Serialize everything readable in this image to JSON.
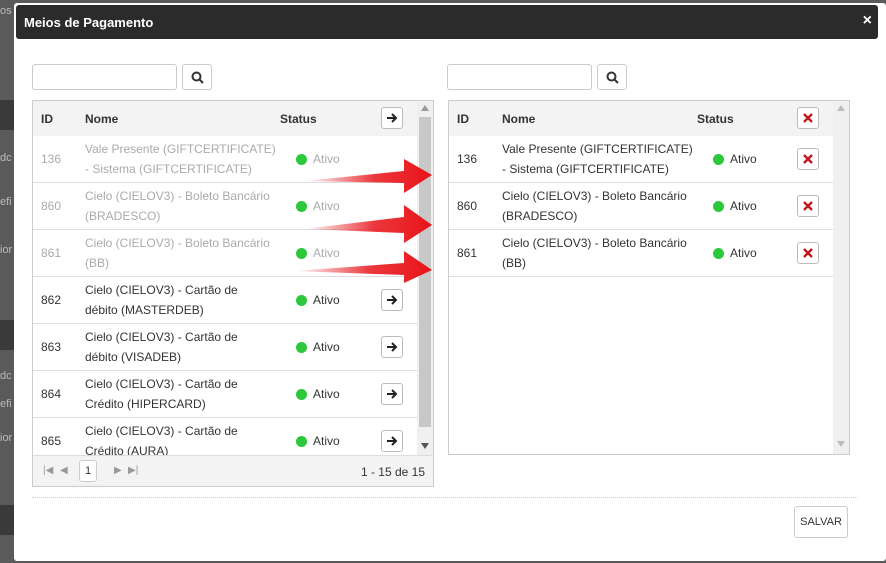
{
  "background": {
    "fragments": [
      "os",
      "dc",
      "efi",
      "ior",
      "dc",
      "efi",
      "ior"
    ]
  },
  "modal": {
    "title": "Meios de Pagamento",
    "close_label": "×"
  },
  "left": {
    "search_placeholder": "",
    "headers": {
      "id": "ID",
      "nome": "Nome",
      "status": "Status"
    },
    "rows": [
      {
        "id": "136",
        "nome_line1": "Vale Presente (GIFTCERTIFICATE)",
        "nome_line2": "- Sistema (GIFTCERTIFICATE)",
        "status": "Ativo",
        "faded": true
      },
      {
        "id": "860",
        "nome_line1": "Cielo (CIELOV3) - Boleto Bancário",
        "nome_line2": "(BRADESCO)",
        "status": "Ativo",
        "faded": true
      },
      {
        "id": "861",
        "nome_line1": "Cielo (CIELOV3) - Boleto Bancário",
        "nome_line2": "(BB)",
        "status": "Ativo",
        "faded": true
      },
      {
        "id": "862",
        "nome_line1": "Cielo (CIELOV3) - Cartão de",
        "nome_line2": "débito (MASTERDEB)",
        "status": "Ativo",
        "faded": false
      },
      {
        "id": "863",
        "nome_line1": "Cielo (CIELOV3) - Cartão de",
        "nome_line2": "débito (VISADEB)",
        "status": "Ativo",
        "faded": false
      },
      {
        "id": "864",
        "nome_line1": "Cielo (CIELOV3) - Cartão de",
        "nome_line2": "Crédito (HIPERCARD)",
        "status": "Ativo",
        "faded": false
      },
      {
        "id": "865",
        "nome_line1": "Cielo (CIELOV3) - Cartão de",
        "nome_line2": "Crédito (AURA)",
        "status": "Ativo",
        "faded": false
      }
    ],
    "pager": {
      "page": "1",
      "info": "1 - 15 de 15"
    }
  },
  "right": {
    "search_placeholder": "",
    "headers": {
      "id": "ID",
      "nome": "Nome",
      "status": "Status"
    },
    "rows": [
      {
        "id": "136",
        "nome_line1": "Vale Presente (GIFTCERTIFICATE)",
        "nome_line2": "- Sistema (GIFTCERTIFICATE)",
        "status": "Ativo"
      },
      {
        "id": "860",
        "nome_line1": "Cielo (CIELOV3) - Boleto Bancário",
        "nome_line2": "(BRADESCO)",
        "status": "Ativo"
      },
      {
        "id": "861",
        "nome_line1": "Cielo (CIELOV3) - Boleto Bancário",
        "nome_line2": "(BB)",
        "status": "Ativo"
      }
    ]
  },
  "footer": {
    "save_label": "SALVAR"
  },
  "colors": {
    "status_active": "#2dc73c",
    "remove_red": "#c0161c",
    "arrow_red": "#e8141a"
  }
}
